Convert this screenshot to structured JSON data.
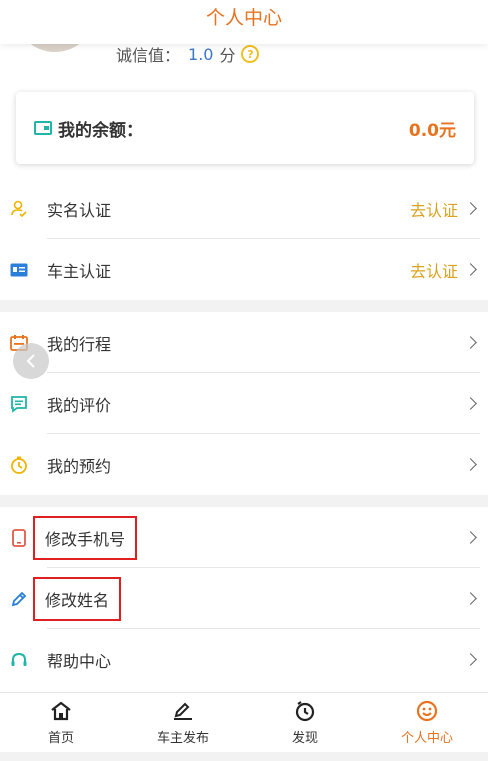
{
  "header": {
    "title": "个人中心"
  },
  "profile": {
    "credit_label": "诚信值：",
    "credit_value": "1.0",
    "credit_unit": "分",
    "help_glyph": "?"
  },
  "balance": {
    "label": "我的余额：",
    "amount": "0.0元"
  },
  "section1": [
    {
      "label": "实名认证",
      "action": "去认证",
      "icon": "user-verify-icon"
    },
    {
      "label": "车主认证",
      "action": "去认证",
      "icon": "id-card-icon"
    }
  ],
  "section2": [
    {
      "label": "我的行程",
      "icon": "calendar-icon"
    },
    {
      "label": "我的评价",
      "icon": "comment-icon"
    },
    {
      "label": "我的预约",
      "icon": "clock-icon"
    }
  ],
  "section3": [
    {
      "label": "修改手机号",
      "icon": "phone-icon"
    },
    {
      "label": "修改姓名",
      "icon": "pencil-icon"
    },
    {
      "label": "帮助中心",
      "icon": "headset-icon"
    }
  ],
  "tabbar": [
    {
      "label": "首页",
      "icon": "home-icon"
    },
    {
      "label": "车主发布",
      "icon": "publish-icon"
    },
    {
      "label": "发现",
      "icon": "discover-icon"
    },
    {
      "label": "个人中心",
      "icon": "smile-icon",
      "active": true
    }
  ],
  "colors": {
    "accent": "#e8731f",
    "action": "#d9a21e",
    "link": "#3a78c9",
    "highlight_box": "#e02020"
  }
}
